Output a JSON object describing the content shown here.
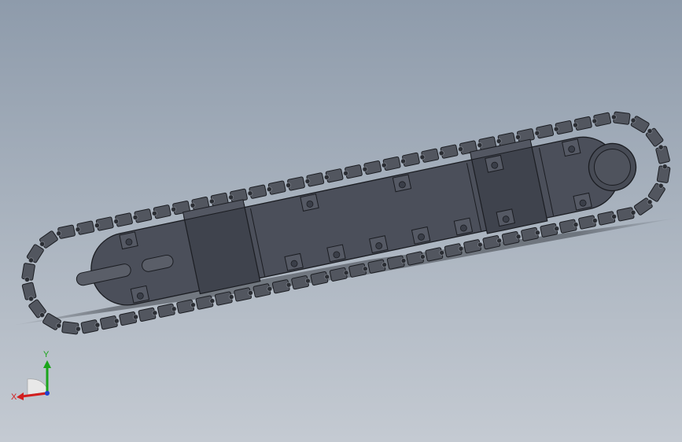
{
  "model": {
    "name": "crawler-track-assembly",
    "colors": {
      "body": "#4b4f5a",
      "body_dark": "#3a3e48",
      "edge": "#1b1d22",
      "link": "#52565f",
      "shadow": "#3d4148"
    }
  },
  "triad": {
    "x_label": "X",
    "y_label": "Y",
    "colors": {
      "x": "#d21f1f",
      "y": "#1aa51a",
      "z": "#1f3fd2"
    }
  }
}
